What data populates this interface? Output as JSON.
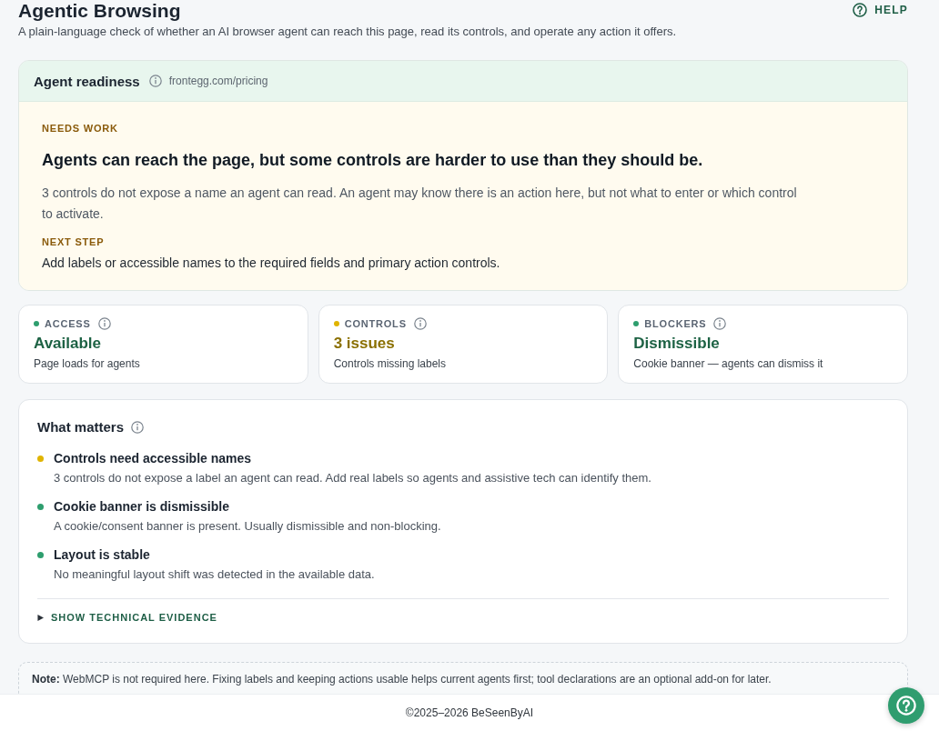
{
  "header": {
    "title": "Agentic Browsing",
    "subtitle": "A plain-language check of whether an AI browser agent can reach this page, read its controls, and operate any action it offers.",
    "help_label": "HELP"
  },
  "readiness": {
    "title": "Agent readiness",
    "url": "frontegg.com/pricing",
    "status_label": "NEEDS WORK",
    "headline": "Agents can reach the page, but some controls are harder to use than they should be.",
    "description": "3 controls do not expose a name an agent can read. An agent may know there is an action here, but not what to enter or which control to activate.",
    "next_step_label": "NEXT STEP",
    "next_step": "Add labels or accessible names to the required fields and primary action controls."
  },
  "stats": [
    {
      "label": "ACCESS",
      "color": "#2e9e6e",
      "value": "Available",
      "detail": "Page loads for agents"
    },
    {
      "label": "CONTROLS",
      "color": "#e0b400",
      "value": "3 issues",
      "detail": "Controls missing labels"
    },
    {
      "label": "BLOCKERS",
      "color": "#2e9e6e",
      "value": "Dismissible",
      "detail": "Cookie banner — agents can dismiss it"
    }
  ],
  "what_matters": {
    "title": "What matters",
    "items": [
      {
        "color": "#e0b400",
        "title": "Controls need accessible names",
        "description": "3 controls do not expose a label an agent can read. Add real labels so agents and assistive tech can identify them."
      },
      {
        "color": "#2e9e6e",
        "title": "Cookie banner is dismissible",
        "description": "A cookie/consent banner is present. Usually dismissible and non-blocking."
      },
      {
        "color": "#2e9e6e",
        "title": "Layout is stable",
        "description": "No meaningful layout shift was detected in the available data."
      }
    ],
    "toggle": {
      "label": "SHOW TECHNICAL EVIDENCE",
      "expanded": false
    }
  },
  "note": {
    "text": "**Note:** WebMCP is not required here. Fixing labels and keeping actions usable helps current agents first; tool declarations are an optional add-on for later."
  },
  "footer": {
    "text": "©2025–2026 BeSeenByAI"
  }
}
